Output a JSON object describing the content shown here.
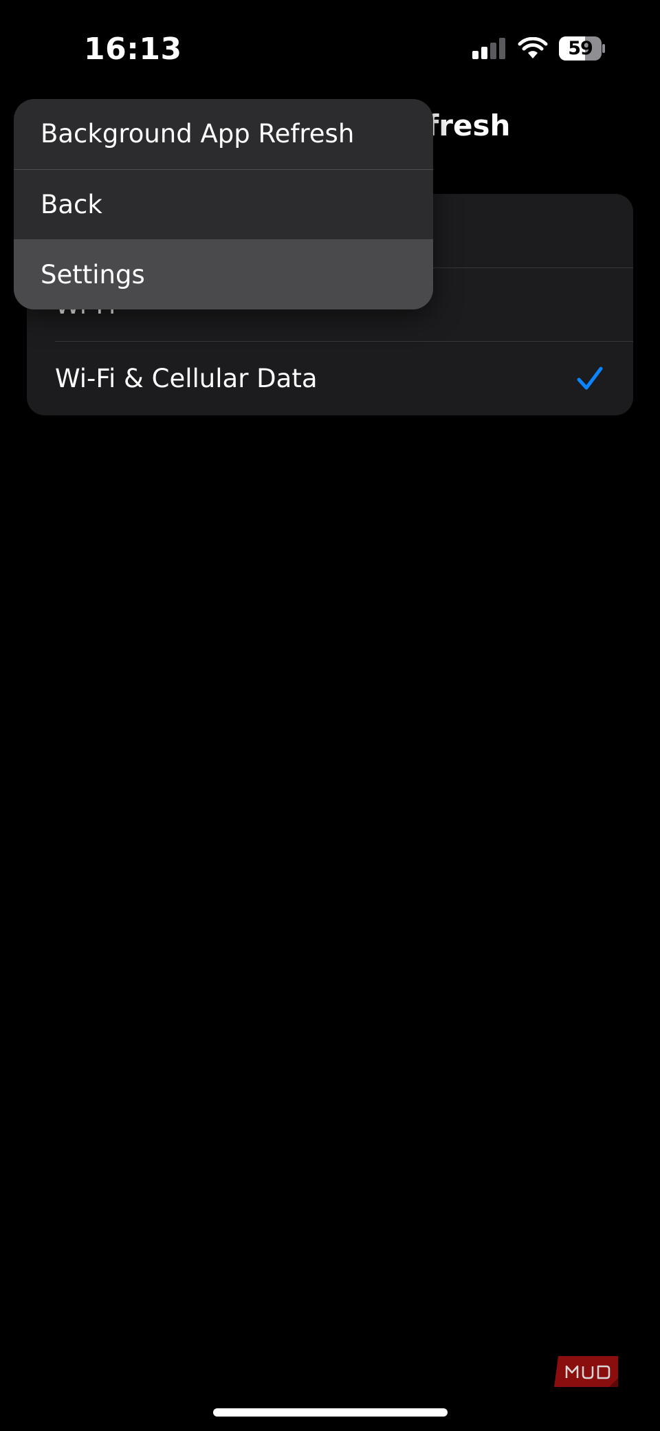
{
  "status_bar": {
    "time": "16:13",
    "battery_level": "59",
    "signal_bars_active": 2,
    "signal_bars_total": 4,
    "icons": [
      "signal-icon",
      "wifi-icon",
      "battery-icon"
    ]
  },
  "page": {
    "title_visible_fragment": "fresh",
    "options": [
      {
        "label": ""
      },
      {
        "label": "Wi-Fi"
      },
      {
        "label": "Wi-Fi & Cellular Data",
        "selected": true
      }
    ]
  },
  "context_menu": {
    "items": [
      {
        "label": "Background App Refresh"
      },
      {
        "label": "Back"
      },
      {
        "label": "Settings",
        "highlighted": true
      }
    ]
  },
  "watermark": {
    "text": "MUO",
    "color": "#8b0e0e"
  },
  "colors": {
    "accent": "#0a84ff",
    "background": "#000000",
    "card": "#1c1c1e",
    "menu": "#2c2c2e",
    "menu_highlight": "#4a4a4c"
  }
}
